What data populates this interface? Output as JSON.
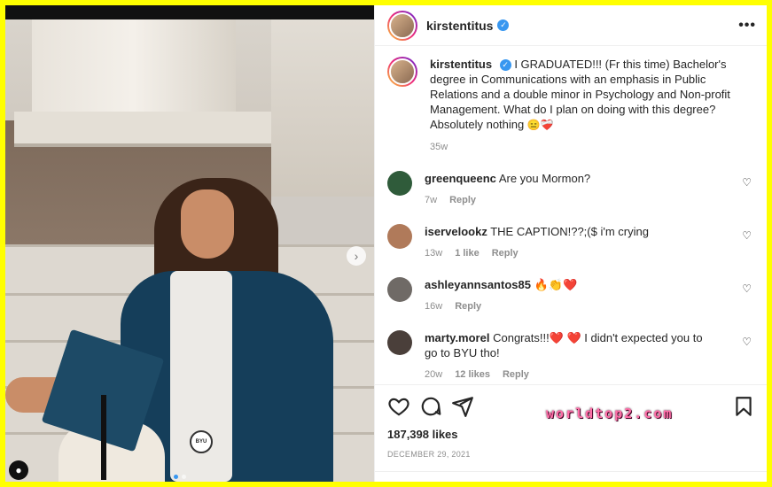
{
  "post": {
    "username": "kirstentitus",
    "verified_mark": "✓",
    "more_label": "•••",
    "caption": "I GRADUATED!!! (Fr this time) Bachelor's degree in Communications with an emphasis in Public Relations and a double minor in Psychology and Non-profit Management. What do I plan on doing with this degree? Absolutely nothing",
    "caption_emojis": "😑❤️‍🩹",
    "caption_time": "35w",
    "likes": "187,398 likes",
    "date": "DECEMBER 29, 2021"
  },
  "comments": [
    {
      "user": "greenqueenc",
      "text": "Are you Mormon?",
      "time": "7w",
      "likes": "",
      "reply": "Reply",
      "avatar_color": "#2f5b3a"
    },
    {
      "user": "iservelookz",
      "text": "THE CAPTION!??;($ i'm crying",
      "time": "13w",
      "likes": "1 like",
      "reply": "Reply",
      "avatar_color": "#b07a5a"
    },
    {
      "user": "ashleyannsantos85",
      "text": "🔥👏❤️",
      "time": "16w",
      "likes": "",
      "reply": "Reply",
      "avatar_color": "#6f6a66"
    },
    {
      "user": "marty.morel",
      "text": "Congrats!!!❤️ ❤️ I didn't expected you to go to BYU tho!",
      "time": "20w",
      "likes": "12 likes",
      "reply": "Reply",
      "avatar_color": "#4a3f3a"
    }
  ],
  "photo": {
    "seal_text": "BYU",
    "next_arrow": "›",
    "user_tag": "●"
  },
  "icons": [
    "heart-icon",
    "comment-icon",
    "share-icon",
    "bookmark-icon"
  ],
  "watermark": "worldtop2.com",
  "colors": {
    "frame": "#ffff00",
    "verified": "#3897f0",
    "gown": "#153e5a"
  }
}
